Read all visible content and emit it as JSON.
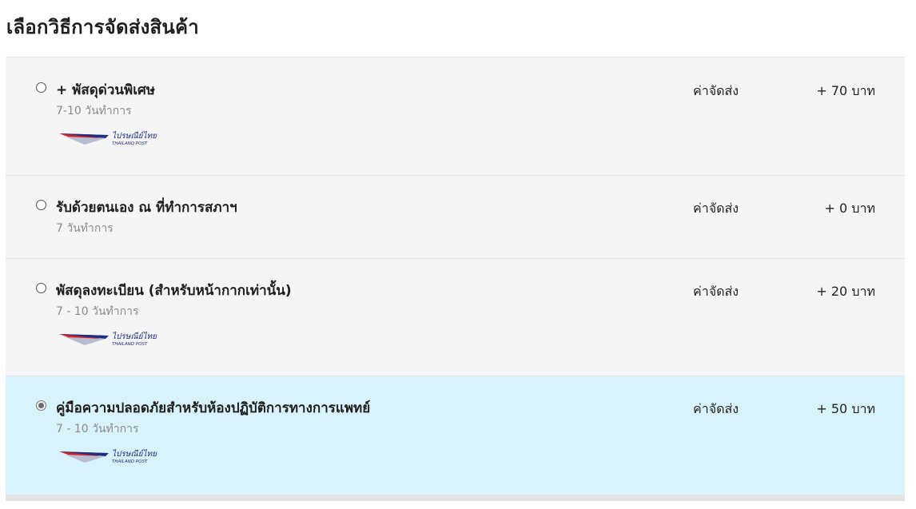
{
  "page_title": "เลือกวิธีการจัดส่งสินค้า",
  "fee_label": "ค่าจัดส่ง",
  "logo": {
    "icon": "thailand-post-logo",
    "text_th": "ไปรษณีย์ไทย",
    "text_en": "THAILAND POST",
    "colors": {
      "red": "#d6202a",
      "navy": "#1c2f80"
    }
  },
  "colors": {
    "selected_row_bg": "#d9f3fc",
    "row_bg": "#f5f5f5"
  },
  "options": [
    {
      "name": "+ พัสดุด่วนพิเศษ",
      "duration": "7-10 วันทำการ",
      "fee": "+ 70 บาท",
      "selected": false,
      "has_logo": true
    },
    {
      "name": "รับด้วยตนเอง ณ ที่ทำการสภาฯ",
      "duration": "7 วันทำการ",
      "fee": "+ 0 บาท",
      "selected": false,
      "has_logo": false
    },
    {
      "name": "พัสดุลงทะเบียน (สำหรับหน้ากากเท่านั้น)",
      "duration": "7 - 10 วันทำการ",
      "fee": "+ 20 บาท",
      "selected": false,
      "has_logo": true
    },
    {
      "name": "คู่มือความปลอดภัยสำหรับห้องปฏิบัติการทางการแพทย์",
      "duration": "7 - 10 วันทำการ",
      "fee": "+ 50 บาท",
      "selected": true,
      "has_logo": true
    }
  ]
}
